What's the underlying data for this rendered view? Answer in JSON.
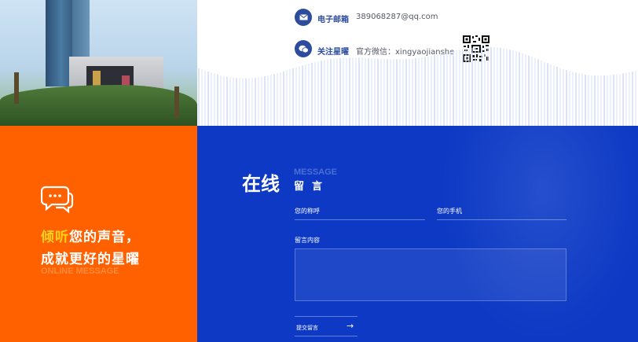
{
  "left": {
    "slogan_highlight": "倾听",
    "slogan_line1_rest": "您的声音，",
    "slogan_line2": "成就更好的星曜",
    "slogan_en": "ONLINE MESSAGE"
  },
  "contact": {
    "email_label": "电子邮箱",
    "email_value": "389068287@qq.com",
    "follow_label": "关注星曜",
    "wechat_value": "官方微信：xingyaojianshe"
  },
  "form": {
    "title_cn": "在线",
    "title_en": "MESSAGE",
    "title_sub": "留言",
    "name_label": "您的称呼",
    "phone_label": "您的手机",
    "content_label": "留言内容",
    "submit_label": "提交留言",
    "submit_arrow": "→"
  },
  "colors": {
    "orange": "#ff6100",
    "blue": "#0d39c4",
    "accent_yellow": "#ffd21a",
    "contact_blue": "#2e4c9e"
  },
  "icons": {
    "email": "envelope-icon",
    "wechat": "wechat-icon",
    "chat": "chat-bubbles-icon",
    "qr": "qr-code"
  }
}
